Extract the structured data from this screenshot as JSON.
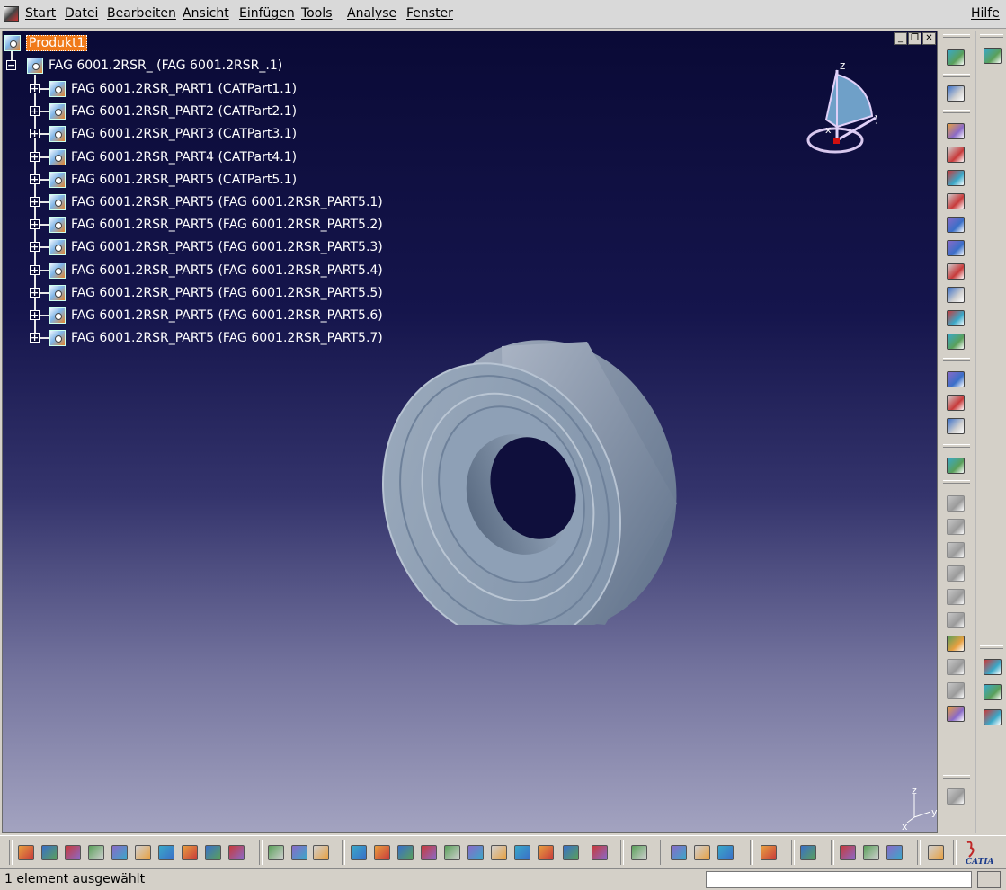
{
  "menubar": {
    "items": [
      "Start",
      "Datei",
      "Bearbeiten",
      "Ansicht",
      "Einfügen",
      "Tools",
      "Analyse",
      "Fenster"
    ],
    "help": "Hilfe"
  },
  "tree": {
    "root": "Produkt1",
    "assembly": "FAG 6001.2RSR_ (FAG 6001.2RSR_.1)",
    "parts": [
      "FAG 6001.2RSR_PART1 (CATPart1.1)",
      "FAG 6001.2RSR_PART2 (CATPart2.1)",
      "FAG 6001.2RSR_PART3 (CATPart3.1)",
      "FAG 6001.2RSR_PART4 (CATPart4.1)",
      "FAG 6001.2RSR_PART5 (CATPart5.1)",
      "FAG 6001.2RSR_PART5 (FAG 6001.2RSR_PART5.1)",
      "FAG 6001.2RSR_PART5 (FAG 6001.2RSR_PART5.2)",
      "FAG 6001.2RSR_PART5 (FAG 6001.2RSR_PART5.3)",
      "FAG 6001.2RSR_PART5 (FAG 6001.2RSR_PART5.4)",
      "FAG 6001.2RSR_PART5 (FAG 6001.2RSR_PART5.5)",
      "FAG 6001.2RSR_PART5 (FAG 6001.2RSR_PART5.6)",
      "FAG 6001.2RSR_PART5 (FAG 6001.2RSR_PART5.7)"
    ]
  },
  "compass": {
    "z": "z",
    "y": "y",
    "x": "x"
  },
  "mini_axes": {
    "z": "z",
    "y": "y",
    "x": "x"
  },
  "status": {
    "text": "1 element ausgewählt",
    "command_value": ""
  },
  "logo": {
    "text": "CATIA"
  },
  "colors": {
    "selection": "#f07a1a",
    "background_top": "#0a0a36",
    "background_bottom": "#a3a3c0",
    "part": "#8b9bb0"
  },
  "icons": {
    "right_toolbar": [
      "select-arrow-icon",
      "select-pointer-icon",
      "new-component-icon",
      "new-product-icon",
      "new-part-icon",
      "existing-component-icon",
      "replace-component-icon",
      "graph-tree-icon",
      "generate-numbering-icon",
      "selective-load-icon",
      "manage-representations-icon",
      "multi-instantiation-icon",
      "manipulate-icon",
      "snap-icon",
      "explode-icon",
      "scene-icon",
      "coincidence-icon",
      "contact-icon",
      "offset-icon",
      "angle-icon",
      "fix-icon",
      "fix-together-icon",
      "quick-constraint-icon",
      "flexible-icon",
      "change-constraint-icon",
      "reuse-pattern-icon"
    ],
    "right_toolbar2": [
      "compass-gear-icon",
      "measure-between-icon",
      "measure-item-icon",
      "measure-inertia-icon",
      "sketcher-icon"
    ]
  }
}
